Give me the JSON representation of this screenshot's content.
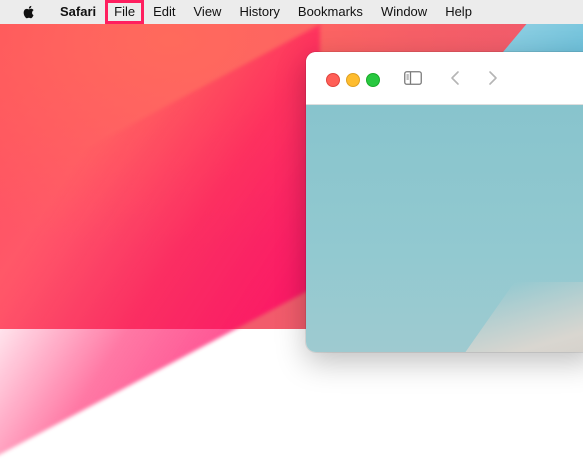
{
  "menubar": {
    "apple_icon": "apple-logo-icon",
    "app_name": "Safari",
    "items": [
      "File",
      "Edit",
      "View",
      "History",
      "Bookmarks",
      "Window",
      "Help"
    ],
    "highlighted_item": "File",
    "highlight_color": "#ff1f5f",
    "background": "#ececec"
  },
  "window": {
    "traffic_lights": {
      "close_color": "#ff5f57",
      "minimize_color": "#febc2e",
      "zoom_color": "#28c840"
    },
    "toolbar_icons": [
      "sidebar-toggle-icon",
      "chevron-left-icon",
      "chevron-right-icon"
    ]
  },
  "desktop": {
    "colors": [
      "#ff4a5c",
      "#ff0a5a",
      "#8ecfe2"
    ]
  }
}
